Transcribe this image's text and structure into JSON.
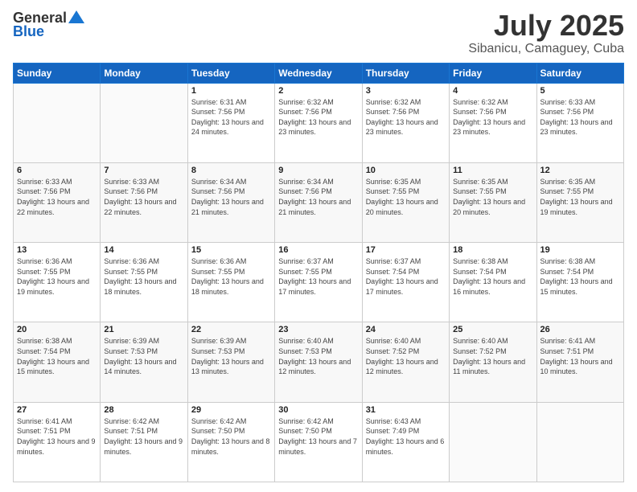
{
  "header": {
    "logo_general": "General",
    "logo_blue": "Blue",
    "title": "July 2025",
    "subtitle": "Sibanicu, Camaguey, Cuba"
  },
  "weekdays": [
    "Sunday",
    "Monday",
    "Tuesday",
    "Wednesday",
    "Thursday",
    "Friday",
    "Saturday"
  ],
  "weeks": [
    [
      {
        "day": "",
        "info": ""
      },
      {
        "day": "",
        "info": ""
      },
      {
        "day": "1",
        "info": "Sunrise: 6:31 AM\nSunset: 7:56 PM\nDaylight: 13 hours and 24 minutes."
      },
      {
        "day": "2",
        "info": "Sunrise: 6:32 AM\nSunset: 7:56 PM\nDaylight: 13 hours and 23 minutes."
      },
      {
        "day": "3",
        "info": "Sunrise: 6:32 AM\nSunset: 7:56 PM\nDaylight: 13 hours and 23 minutes."
      },
      {
        "day": "4",
        "info": "Sunrise: 6:32 AM\nSunset: 7:56 PM\nDaylight: 13 hours and 23 minutes."
      },
      {
        "day": "5",
        "info": "Sunrise: 6:33 AM\nSunset: 7:56 PM\nDaylight: 13 hours and 23 minutes."
      }
    ],
    [
      {
        "day": "6",
        "info": "Sunrise: 6:33 AM\nSunset: 7:56 PM\nDaylight: 13 hours and 22 minutes."
      },
      {
        "day": "7",
        "info": "Sunrise: 6:33 AM\nSunset: 7:56 PM\nDaylight: 13 hours and 22 minutes."
      },
      {
        "day": "8",
        "info": "Sunrise: 6:34 AM\nSunset: 7:56 PM\nDaylight: 13 hours and 21 minutes."
      },
      {
        "day": "9",
        "info": "Sunrise: 6:34 AM\nSunset: 7:56 PM\nDaylight: 13 hours and 21 minutes."
      },
      {
        "day": "10",
        "info": "Sunrise: 6:35 AM\nSunset: 7:55 PM\nDaylight: 13 hours and 20 minutes."
      },
      {
        "day": "11",
        "info": "Sunrise: 6:35 AM\nSunset: 7:55 PM\nDaylight: 13 hours and 20 minutes."
      },
      {
        "day": "12",
        "info": "Sunrise: 6:35 AM\nSunset: 7:55 PM\nDaylight: 13 hours and 19 minutes."
      }
    ],
    [
      {
        "day": "13",
        "info": "Sunrise: 6:36 AM\nSunset: 7:55 PM\nDaylight: 13 hours and 19 minutes."
      },
      {
        "day": "14",
        "info": "Sunrise: 6:36 AM\nSunset: 7:55 PM\nDaylight: 13 hours and 18 minutes."
      },
      {
        "day": "15",
        "info": "Sunrise: 6:36 AM\nSunset: 7:55 PM\nDaylight: 13 hours and 18 minutes."
      },
      {
        "day": "16",
        "info": "Sunrise: 6:37 AM\nSunset: 7:55 PM\nDaylight: 13 hours and 17 minutes."
      },
      {
        "day": "17",
        "info": "Sunrise: 6:37 AM\nSunset: 7:54 PM\nDaylight: 13 hours and 17 minutes."
      },
      {
        "day": "18",
        "info": "Sunrise: 6:38 AM\nSunset: 7:54 PM\nDaylight: 13 hours and 16 minutes."
      },
      {
        "day": "19",
        "info": "Sunrise: 6:38 AM\nSunset: 7:54 PM\nDaylight: 13 hours and 15 minutes."
      }
    ],
    [
      {
        "day": "20",
        "info": "Sunrise: 6:38 AM\nSunset: 7:54 PM\nDaylight: 13 hours and 15 minutes."
      },
      {
        "day": "21",
        "info": "Sunrise: 6:39 AM\nSunset: 7:53 PM\nDaylight: 13 hours and 14 minutes."
      },
      {
        "day": "22",
        "info": "Sunrise: 6:39 AM\nSunset: 7:53 PM\nDaylight: 13 hours and 13 minutes."
      },
      {
        "day": "23",
        "info": "Sunrise: 6:40 AM\nSunset: 7:53 PM\nDaylight: 13 hours and 12 minutes."
      },
      {
        "day": "24",
        "info": "Sunrise: 6:40 AM\nSunset: 7:52 PM\nDaylight: 13 hours and 12 minutes."
      },
      {
        "day": "25",
        "info": "Sunrise: 6:40 AM\nSunset: 7:52 PM\nDaylight: 13 hours and 11 minutes."
      },
      {
        "day": "26",
        "info": "Sunrise: 6:41 AM\nSunset: 7:51 PM\nDaylight: 13 hours and 10 minutes."
      }
    ],
    [
      {
        "day": "27",
        "info": "Sunrise: 6:41 AM\nSunset: 7:51 PM\nDaylight: 13 hours and 9 minutes."
      },
      {
        "day": "28",
        "info": "Sunrise: 6:42 AM\nSunset: 7:51 PM\nDaylight: 13 hours and 9 minutes."
      },
      {
        "day": "29",
        "info": "Sunrise: 6:42 AM\nSunset: 7:50 PM\nDaylight: 13 hours and 8 minutes."
      },
      {
        "day": "30",
        "info": "Sunrise: 6:42 AM\nSunset: 7:50 PM\nDaylight: 13 hours and 7 minutes."
      },
      {
        "day": "31",
        "info": "Sunrise: 6:43 AM\nSunset: 7:49 PM\nDaylight: 13 hours and 6 minutes."
      },
      {
        "day": "",
        "info": ""
      },
      {
        "day": "",
        "info": ""
      }
    ]
  ]
}
